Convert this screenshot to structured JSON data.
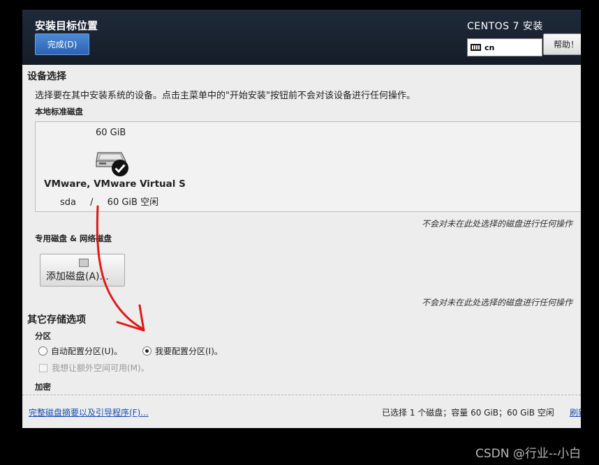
{
  "header": {
    "title": "安装目标位置",
    "done_button": "完成(D)",
    "product": "CENTOS 7 安装",
    "keyboard_layout": "cn",
    "help_button": "帮助！"
  },
  "device_selection": {
    "title": "设备选择",
    "description": "选择要在其中安装系统的设备。点击主菜单中的\"开始安装\"按钮前不会对该设备进行任何操作。"
  },
  "local_disks": {
    "title": "本地标准磁盘",
    "disk": {
      "size": "60 GiB",
      "name": "VMware, VMware Virtual S",
      "device": "sda",
      "separator": "/",
      "free": "60 GiB 空闲",
      "selected": true
    },
    "note": "不会对未在此处选择的磁盘进行任何操作"
  },
  "special_disks": {
    "title": "专用磁盘 & 网络磁盘",
    "add_button": "添加磁盘(A)...",
    "note": "不会对未在此处选择的磁盘进行任何操作"
  },
  "other_options": {
    "title": "其它存储选项",
    "partition_title": "分区",
    "auto_partition": "自动配置分区(U)。",
    "manual_partition": "我要配置分区(I)。",
    "selected_partition": "manual",
    "extra_space": "我想让额外空间可用(M)。",
    "encryption_title": "加密"
  },
  "footer": {
    "summary_link": "完整磁盘摘要以及引导程序(F)...",
    "status": "已选择 1 个磁盘；容量 60 GiB；60 GiB 空闲",
    "refresh": "刷新"
  },
  "watermark": "CSDN @行业--小白",
  "colors": {
    "header_bg": "#1f2a3a",
    "primary_button": "#2c63b5",
    "link": "#1a4fb0",
    "annotation": "#e01818"
  }
}
